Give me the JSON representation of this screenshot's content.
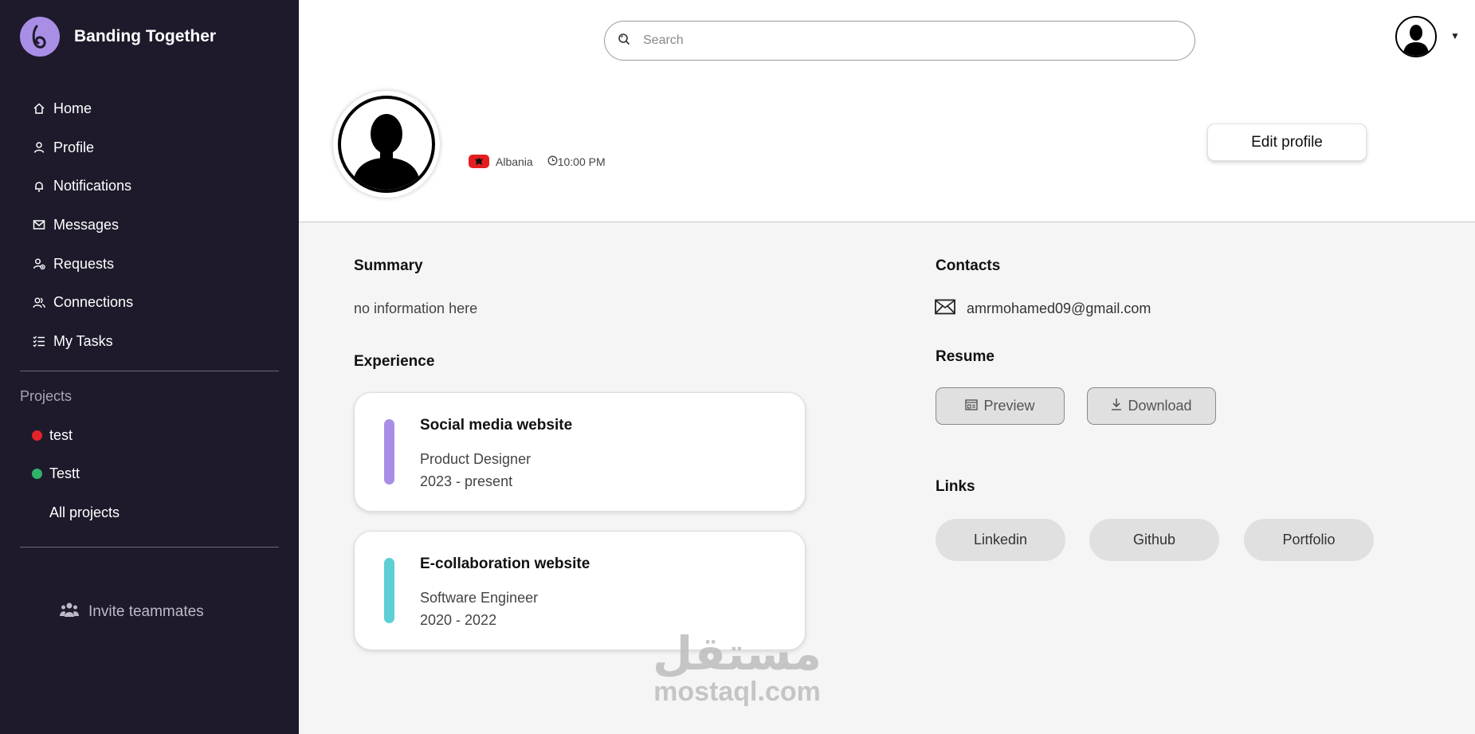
{
  "brand": {
    "name": "Banding Together"
  },
  "nav": {
    "items": [
      {
        "label": "Home",
        "icon": "home-icon"
      },
      {
        "label": "Profile",
        "icon": "user-icon"
      },
      {
        "label": "Notifications",
        "icon": "bell-icon"
      },
      {
        "label": "Messages",
        "icon": "mail-icon"
      },
      {
        "label": "Requests",
        "icon": "user-plus-icon"
      },
      {
        "label": "Connections",
        "icon": "users-icon"
      },
      {
        "label": "My Tasks",
        "icon": "checklist-icon"
      }
    ]
  },
  "projects": {
    "title": "Projects",
    "items": [
      {
        "label": "test",
        "color": "#e4232b"
      },
      {
        "label": "Testt",
        "color": "#2fb36a"
      }
    ],
    "all_label": "All projects"
  },
  "invite": {
    "label": "Invite teammates"
  },
  "search": {
    "placeholder": "Search"
  },
  "profile": {
    "country": "Albania",
    "time": "10:00 PM",
    "edit_label": "Edit profile"
  },
  "summary": {
    "title": "Summary",
    "text": "no information here"
  },
  "experience": {
    "title": "Experience",
    "items": [
      {
        "title": "Social media website",
        "role": "Product Designer",
        "dates": "2023 - present",
        "color": "#a98ee6"
      },
      {
        "title": "E-collaboration website",
        "role": "Software Engineer",
        "dates": "2020 - 2022",
        "color": "#5fcfd6"
      }
    ]
  },
  "contacts": {
    "title": "Contacts",
    "email": "amrmohamed09@gmail.com"
  },
  "resume": {
    "title": "Resume",
    "preview_label": "Preview",
    "download_label": "Download"
  },
  "links": {
    "title": "Links",
    "items": [
      "Linkedin",
      "Github",
      "Portfolio"
    ]
  },
  "watermark": {
    "arabic": "مستقل",
    "latin": "mostaql.com"
  }
}
